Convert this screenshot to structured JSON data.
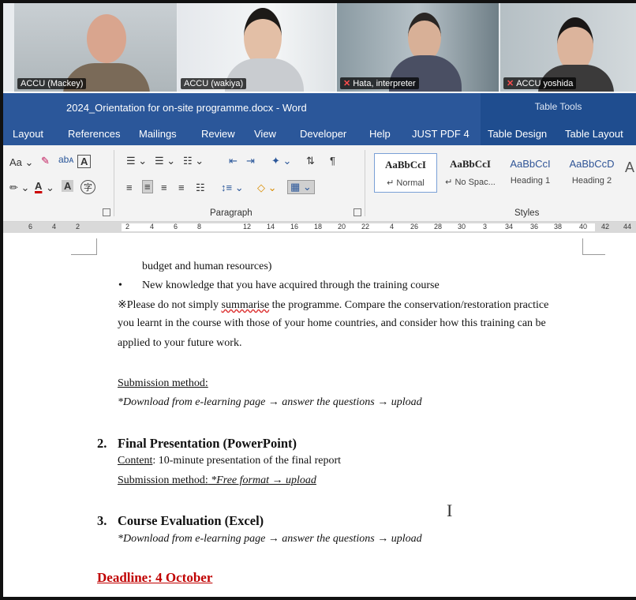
{
  "participants": [
    {
      "name": "ACCU (Mackey)",
      "muted": false,
      "active": true
    },
    {
      "name": "ACCU (wakiya)",
      "muted": false,
      "active": false
    },
    {
      "name": "Hata, interpreter",
      "muted": true,
      "active": false
    },
    {
      "name": "ACCU yoshida",
      "muted": true,
      "active": false
    }
  ],
  "window": {
    "title": "2024_Orientation for on-site programme.docx  -  Word",
    "context_group": "Table Tools"
  },
  "menu": {
    "tabs": [
      "Layout",
      "References",
      "Mailings",
      "Review",
      "View",
      "Developer",
      "Help",
      "JUST PDF 4",
      "Table Design",
      "Table Layout"
    ]
  },
  "ribbon": {
    "font_group": {
      "font_case": "Aa"
    },
    "paragraph_label": "Paragraph",
    "styles_label": "Styles",
    "styles": [
      {
        "sample": "AaBbCcI",
        "name": "↵ Normal"
      },
      {
        "sample": "AaBbCcI",
        "name": "↵ No Spac..."
      },
      {
        "sample": "AaBbCcI",
        "name": "Heading 1"
      },
      {
        "sample": "AaBbCcD",
        "name": "Heading 2"
      }
    ]
  },
  "ruler": {
    "numbers": [
      "6",
      "4",
      "2",
      "2",
      "4",
      "6",
      "8",
      "12",
      "14",
      "16",
      "18",
      "20",
      "22",
      "4",
      "26",
      "28",
      "30",
      "3",
      "34",
      "36",
      "38",
      "40",
      "42",
      "44"
    ]
  },
  "document": {
    "line1": "budget and human resources)",
    "bullet": "New knowledge that you have acquired through the training course",
    "note_prefix": "※Please do not simply ",
    "note_misspelled": "summarise",
    "note_rest": " the programme. Compare the conservation/restoration practice",
    "note_line2": "you learnt in the course with those of your home countries, and consider how this training can be",
    "note_line3": "applied to your future work.",
    "submission_label": "Submission method:",
    "submission_text": "*Download from e-learning page  → answer the questions → upload",
    "item2_num": "2.",
    "item2_title": "Final Presentation (PowerPoint)",
    "item2_content_label": "Content",
    "item2_content_text": ": 10-minute presentation of the final report",
    "item2_submission_label": "Submission method:",
    "item2_submission_text": " *Free format    →    upload",
    "item3_num": "3.",
    "item3_title": "Course Evaluation (Excel)",
    "item3_text": "*Download from e-learning page  → answer the questions → upload",
    "deadline": "Deadline: 4 October"
  }
}
